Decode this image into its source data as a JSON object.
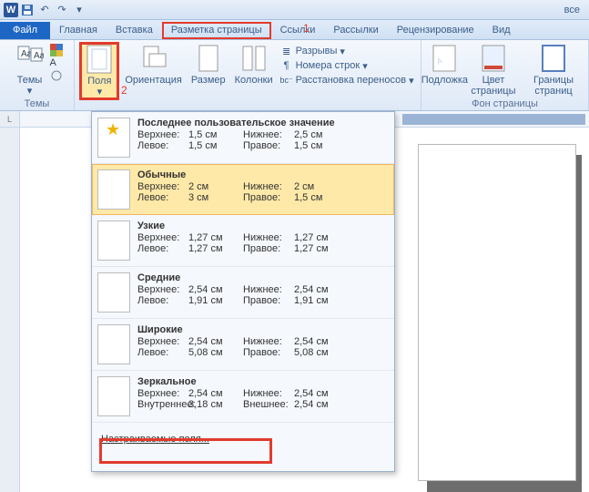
{
  "title_right": "все",
  "annotations": {
    "one": "1",
    "two": "2"
  },
  "tabs": {
    "file": "Файл",
    "home": "Главная",
    "insert": "Вставка",
    "layout": "Разметка страницы",
    "references": "Ссылки",
    "mailings": "Рассылки",
    "review": "Рецензирование",
    "view": "Вид"
  },
  "ribbon": {
    "themes_group": "Темы",
    "themes": "Темы",
    "margins": "Поля",
    "orientation": "Ориентация",
    "size": "Размер",
    "columns": "Колонки",
    "breaks": "Разрывы",
    "line_numbers": "Номера строк",
    "hyphenation": "Расстановка переносов",
    "watermark": "Подложка",
    "page_color": "Цвет страницы",
    "page_borders": "Границы страниц",
    "bg_group": "Фон страницы"
  },
  "ruler_corner": "L",
  "margins_dropdown": {
    "custom": "Настраиваемые поля...",
    "presets": [
      {
        "name": "Последнее пользовательское значение",
        "icon": "star",
        "top_k": "Верхнее:",
        "top_v": "1,5 см",
        "left_k": "Левое:",
        "left_v": "1,5 см",
        "bottom_k": "Нижнее:",
        "bottom_v": "2,5 см",
        "right_k": "Правое:",
        "right_v": "1,5 см"
      },
      {
        "name": "Обычные",
        "selected": true,
        "top_k": "Верхнее:",
        "top_v": "2 см",
        "left_k": "Левое:",
        "left_v": "3 см",
        "bottom_k": "Нижнее:",
        "bottom_v": "2 см",
        "right_k": "Правое:",
        "right_v": "1,5 см"
      },
      {
        "name": "Узкие",
        "top_k": "Верхнее:",
        "top_v": "1,27 см",
        "left_k": "Левое:",
        "left_v": "1,27 см",
        "bottom_k": "Нижнее:",
        "bottom_v": "1,27 см",
        "right_k": "Правое:",
        "right_v": "1,27 см"
      },
      {
        "name": "Средние",
        "top_k": "Верхнее:",
        "top_v": "2,54 см",
        "left_k": "Левое:",
        "left_v": "1,91 см",
        "bottom_k": "Нижнее:",
        "bottom_v": "2,54 см",
        "right_k": "Правое:",
        "right_v": "1,91 см"
      },
      {
        "name": "Широкие",
        "top_k": "Верхнее:",
        "top_v": "2,54 см",
        "left_k": "Левое:",
        "left_v": "5,08 см",
        "bottom_k": "Нижнее:",
        "bottom_v": "2,54 см",
        "right_k": "Правое:",
        "right_v": "5,08 см"
      },
      {
        "name": "Зеркальное",
        "top_k": "Верхнее:",
        "top_v": "2,54 см",
        "left_k": "Внутреннее:",
        "left_v": "3,18 см",
        "bottom_k": "Нижнее:",
        "bottom_v": "2,54 см",
        "right_k": "Внешнее:",
        "right_v": "2,54 см"
      }
    ]
  }
}
